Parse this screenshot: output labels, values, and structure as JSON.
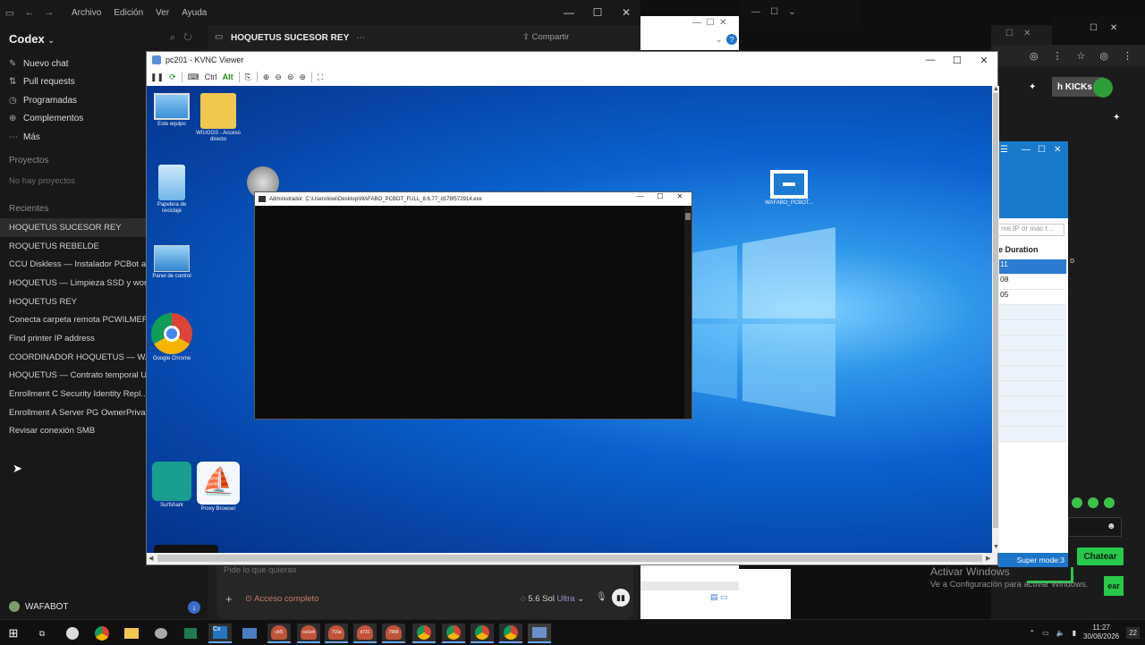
{
  "codex": {
    "menu": [
      "Archivo",
      "Edición",
      "Ver",
      "Ayuda"
    ],
    "brand": "Codex",
    "nav": [
      {
        "icon": "edit-icon",
        "glyph": "✎",
        "label": "Nuevo chat"
      },
      {
        "icon": "pull-request-icon",
        "glyph": "⇅",
        "label": "Pull requests"
      },
      {
        "icon": "clock-icon",
        "glyph": "◷",
        "label": "Programadas"
      },
      {
        "icon": "plugin-icon",
        "glyph": "⊕",
        "label": "Complementos"
      },
      {
        "icon": "more-icon",
        "glyph": "⋯",
        "label": "Más"
      }
    ],
    "projects_heading": "Proyectos",
    "projects_empty": "No hay proyectos",
    "recents_heading": "Recientes",
    "recents": [
      "HOQUETUS SUCESOR REY",
      "ROQUETUS REBELDE",
      "CCU Diskless — Instalador PCBot acu",
      "HOQUETUS — Limpieza SSD y workt",
      "HOQUETUS REY",
      "Conecta carpeta remota PCWILMER",
      "Find printer IP address",
      "COORDINADOR HOQUETUS — WAF",
      "HOQUETUS — Contrato temporal UT",
      "Enrollment C Security Identity Repl...",
      "Enrollment A Server PG OwnerPrivate",
      "Revisar conexión SMB"
    ],
    "user": "WAFABOT",
    "thread_title": "HOQUETUS SUCESOR REY",
    "share_label": "Compartir",
    "composer": {
      "placeholder": "Pide lo que quieras",
      "access": "Acceso completo",
      "model": "5.6 Sol",
      "effort": "Ultra"
    }
  },
  "kvnc": {
    "title": "pc201 - KVNC Viewer",
    "toolbar": {
      "ctrl": "Ctrl",
      "alt": "Alt"
    },
    "desktop_icons": [
      {
        "name": "este-equipo",
        "label": "Este equipo"
      },
      {
        "name": "wiuggs-shortcut",
        "label": "WIUGGS - Acceso directo"
      },
      {
        "name": "papelera",
        "label": "Papelera de reciclaje"
      },
      {
        "name": "panel-control",
        "label": "Panel de control"
      },
      {
        "name": "google-chrome",
        "label": "Google Chrome"
      },
      {
        "name": "wafabo-pcbot",
        "label": "WAFABO_PCBOT..."
      },
      {
        "name": "surfshark",
        "label": "Surfshark"
      },
      {
        "name": "proxy-browser",
        "label": "Proxy Browser"
      }
    ],
    "cmd_title": "Administrador: C:\\Users\\kiwi\\Desktop\\WAFABO_PCBOT_FULL_8.6.77_d178f572914.exe"
  },
  "right": {
    "kicks_label": "h KICKs",
    "panel": {
      "search_placeholder": "me,IP or mac t...",
      "column": "e Duration",
      "rows": [
        "11",
        "08",
        "05",
        "",
        "",
        "",
        "",
        "",
        "",
        "",
        "",
        ""
      ],
      "footer": "Super mode:3"
    },
    "chatear": "Chatear",
    "chatear2": "ear",
    "activate_title": "Activar Windows",
    "activate_sub": "Ve a Configuración para activar Windows."
  },
  "taskbar": {
    "pills": [
      "cbf1",
      "ce1e4",
      "716a",
      "d731",
      "7968"
    ],
    "time": "11:27",
    "date": "30/08/2026",
    "notifications": "22"
  },
  "colors": {
    "accent": "#1979ca",
    "cta": "#26c94a",
    "desktop": "#0a62cf"
  }
}
